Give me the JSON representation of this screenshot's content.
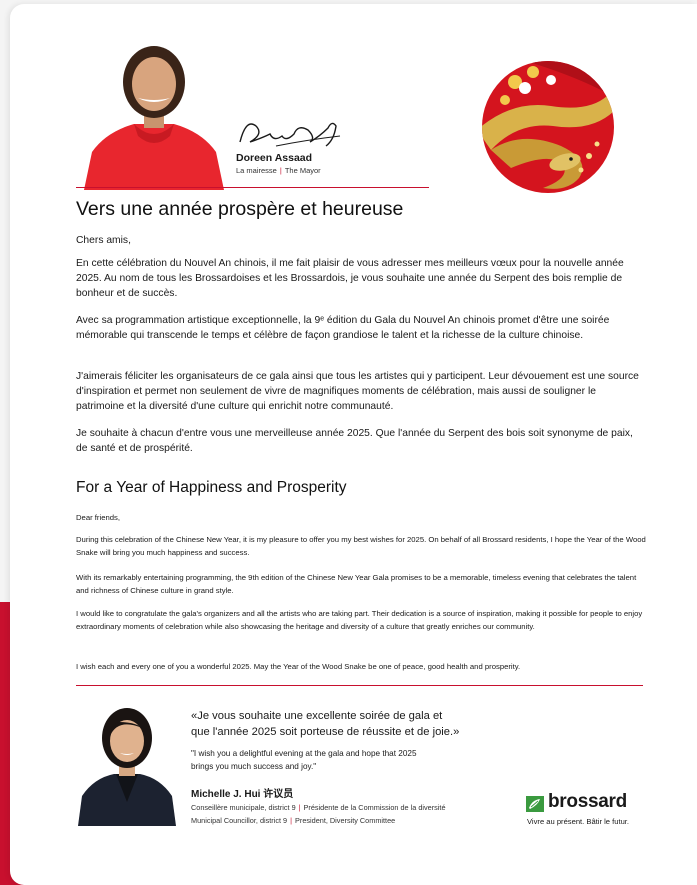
{
  "mayor": {
    "name": "Doreen Assaad",
    "title_fr": "La mairesse",
    "title_en": "The Mayor"
  },
  "french": {
    "heading": "Vers une année prospère et heureuse",
    "greeting": "Chers amis,",
    "paragraphs": [
      "En cette célébration du Nouvel An chinois, il me fait plaisir de vous adresser mes meilleurs vœux pour la nouvelle année 2025. Au nom de tous les Brossardoises et les Brossardois, je vous souhaite une année du Serpent des bois remplie de bonheur et de succès.",
      "Avec sa programmation artistique exceptionnelle, la 9ᵉ édition du Gala du Nouvel An chinois promet d'être une soirée mémorable qui transcende le temps et célèbre de façon grandiose le talent et la richesse de la culture chinoise.",
      "J'aimerais féliciter les organisateurs de ce gala ainsi que tous les artistes qui y participent. Leur dévouement est une source d'inspiration et permet non seulement de vivre de magnifiques moments de célébration, mais aussi de souligner le patrimoine et la diversité d'une culture qui enrichit notre communauté.",
      "Je souhaite à chacun d'entre vous une merveilleuse année 2025. Que l'année du Serpent des bois soit synonyme de paix, de santé et de prospérité."
    ]
  },
  "english": {
    "heading": "For a Year of Happiness and Prosperity",
    "greeting": "Dear friends,",
    "paragraphs": [
      "During this celebration of the Chinese New Year, it is my pleasure to offer you my best wishes for 2025. On behalf of all Brossard residents, I hope the Year of the Wood Snake will bring you much happiness and success.",
      "With its remarkably entertaining programming, the 9th edition of the Chinese New Year Gala promises to be a memorable, timeless evening that celebrates the talent and richness of Chinese culture in grand style.",
      "I would like to congratulate the gala's organizers and all the artists who are taking part. Their dedication is a source of inspiration, making it possible for people to enjoy extraordinary moments of celebration while also showcasing the heritage and diversity of a culture that greatly enriches our community.",
      "I wish each and every one of you a wonderful 2025. May the Year of the Wood Snake be one of peace, good health and prosperity."
    ]
  },
  "councillor": {
    "quote_fr_1": "«Je vous souhaite une excellente soirée de gala et",
    "quote_fr_2": "que l'année 2025 soit porteuse de réussite et de joie.»",
    "quote_en_1": "\"I wish you a delightful evening at the gala and hope that 2025",
    "quote_en_2": "brings you much success and joy.\"",
    "name": "Michelle J. Hui 许议员",
    "role_fr_1": "Conseillère municipale, district 9",
    "role_fr_2": "Présidente de la Commission de la diversité",
    "role_en_1": "Municipal Councillor, district 9",
    "role_en_2": "President, Diversity Committee"
  },
  "brand": {
    "name": "brossard",
    "tagline": "Vivre au présent. Bâtir le futur."
  },
  "colors": {
    "accent_red": "#c8102e",
    "brand_green": "#3a9a3f",
    "gold": "#d9b24a"
  }
}
